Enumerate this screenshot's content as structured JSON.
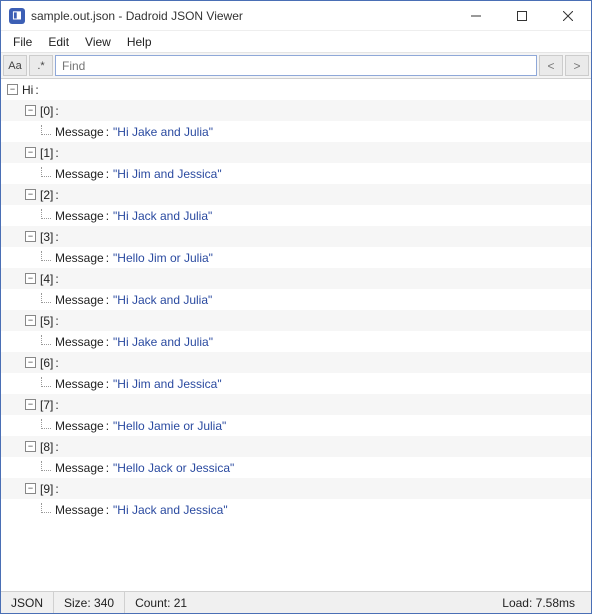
{
  "window": {
    "title": "sample.out.json - Dadroid JSON Viewer"
  },
  "menu": {
    "file": "File",
    "edit": "Edit",
    "view": "View",
    "help": "Help"
  },
  "toolbar": {
    "case_btn": "Aa",
    "regex_btn": ".*",
    "search_placeholder": "Find",
    "prev": "<",
    "next": ">"
  },
  "tree": {
    "root_key": "Hi",
    "message_key": "Message",
    "items": [
      {
        "index": "[0]",
        "value": "\"Hi Jake and Julia\""
      },
      {
        "index": "[1]",
        "value": "\"Hi Jim and Jessica\""
      },
      {
        "index": "[2]",
        "value": "\"Hi Jack and Julia\""
      },
      {
        "index": "[3]",
        "value": "\"Hello Jim or Julia\""
      },
      {
        "index": "[4]",
        "value": "\"Hi Jack and Julia\""
      },
      {
        "index": "[5]",
        "value": "\"Hi Jake and Julia\""
      },
      {
        "index": "[6]",
        "value": "\"Hi Jim and Jessica\""
      },
      {
        "index": "[7]",
        "value": "\"Hello Jamie or Julia\""
      },
      {
        "index": "[8]",
        "value": "\"Hello Jack or Jessica\""
      },
      {
        "index": "[9]",
        "value": "\"Hi Jack and Jessica\""
      }
    ]
  },
  "status": {
    "type": "JSON",
    "size": "Size: 340",
    "count": "Count: 21",
    "load": "Load: 7.58ms"
  }
}
